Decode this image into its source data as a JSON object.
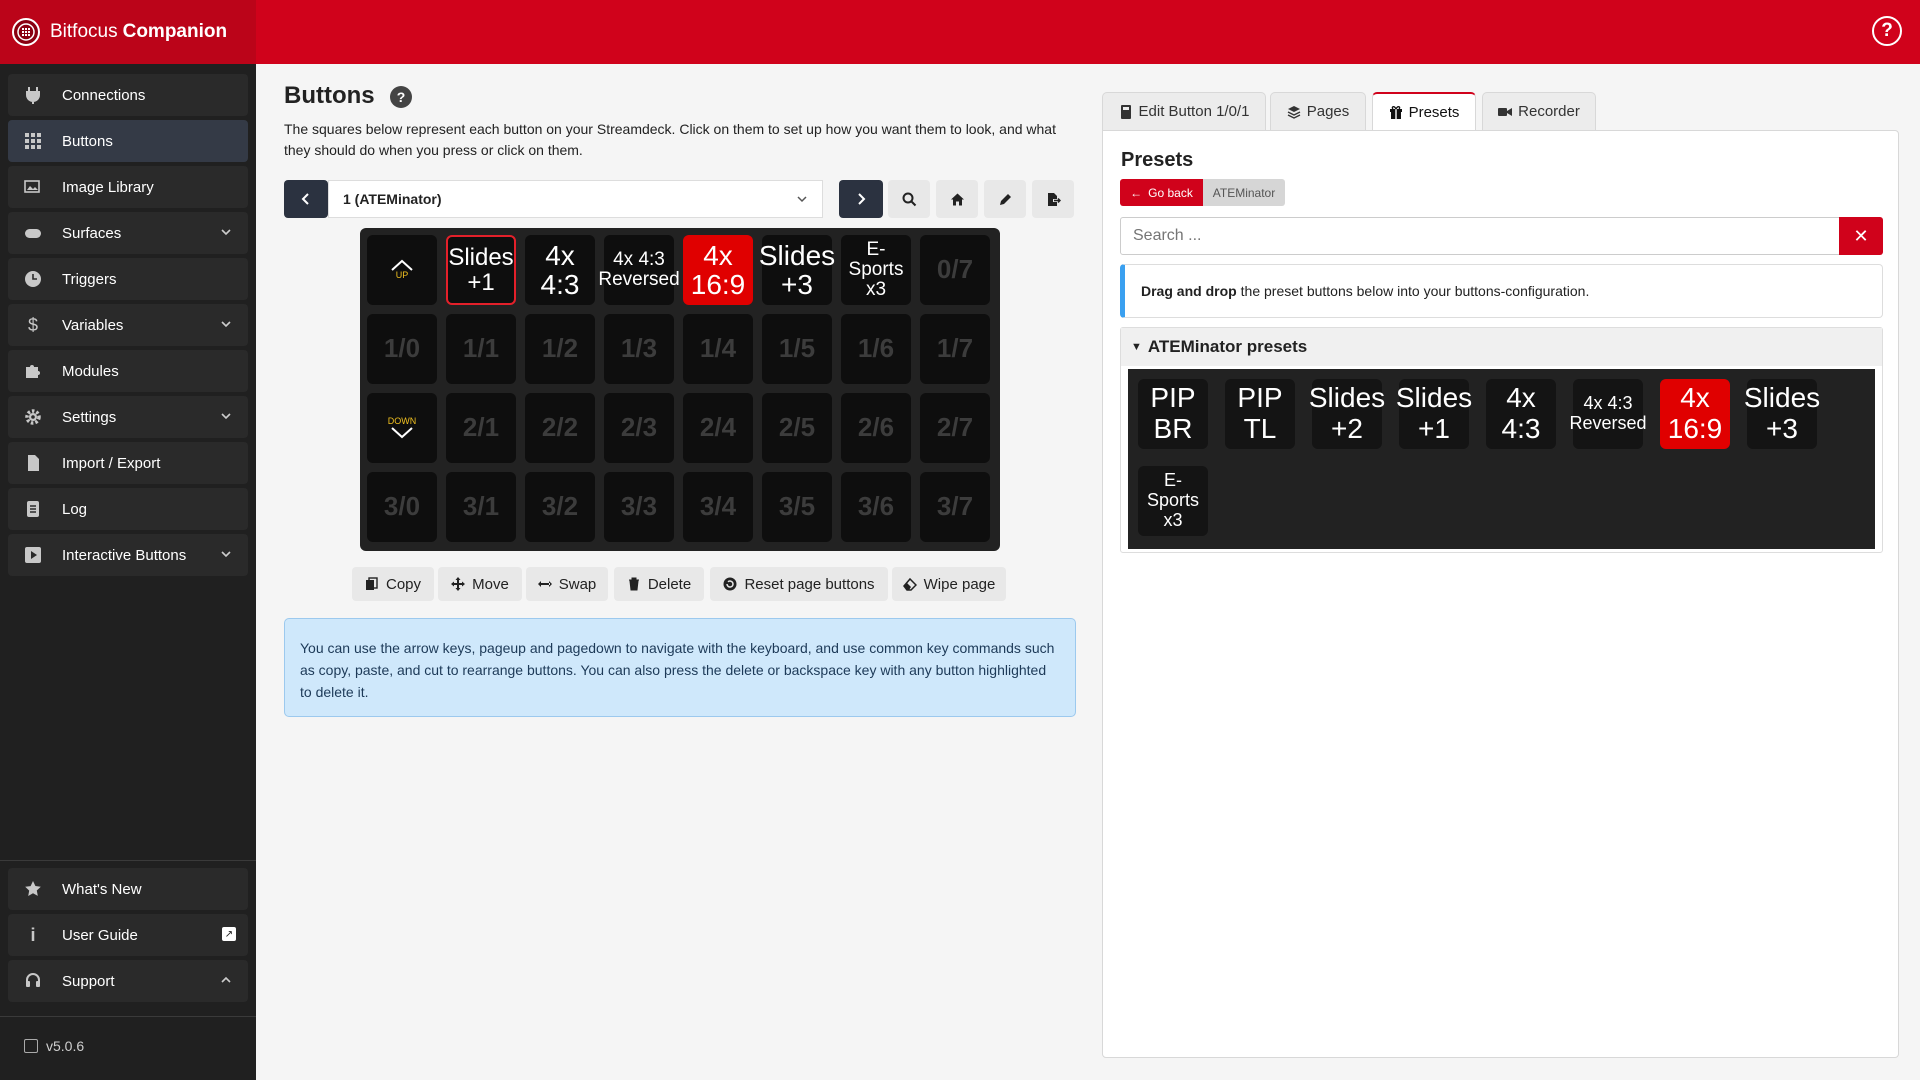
{
  "app": {
    "name_light": "Bitfocus",
    "name_bold": "Companion",
    "help_label": "?"
  },
  "sidebar": {
    "items": [
      {
        "label": "Connections",
        "icon": "plug-icon"
      },
      {
        "label": "Buttons",
        "icon": "grid-icon",
        "active": true
      },
      {
        "label": "Image Library",
        "icon": "image-icon"
      },
      {
        "label": "Surfaces",
        "icon": "gamepad-icon",
        "expandable": true
      },
      {
        "label": "Triggers",
        "icon": "clock-icon"
      },
      {
        "label": "Variables",
        "icon": "dollar-icon",
        "expandable": true
      },
      {
        "label": "Modules",
        "icon": "puzzle-icon"
      },
      {
        "label": "Settings",
        "icon": "gear-icon",
        "expandable": true
      },
      {
        "label": "Import / Export",
        "icon": "file-import-icon"
      },
      {
        "label": "Log",
        "icon": "log-icon"
      },
      {
        "label": "Interactive Buttons",
        "icon": "play-icon",
        "expandable": true
      }
    ],
    "bottom": [
      {
        "label": "What's New",
        "icon": "star-icon"
      },
      {
        "label": "User Guide",
        "icon": "info-icon"
      },
      {
        "label": "Support",
        "icon": "headset-icon"
      }
    ],
    "version": "v5.0.6"
  },
  "buttons_page": {
    "title": "Buttons",
    "description": "The squares below represent each button on your Streamdeck. Click on them to set up how you want them to look, and what they should do when you press or click on them.",
    "page_select": "1 (ATEMinator)",
    "grid": [
      [
        "UP",
        "Slides +1",
        "4x 4:3",
        "4x 4:3 Reversed",
        "4x 16:9",
        "Slides +3",
        "E-Sports x3",
        "0/7"
      ],
      [
        "1/0",
        "1/1",
        "1/2",
        "1/3",
        "1/4",
        "1/5",
        "1/6",
        "1/7"
      ],
      [
        "DOWN",
        "2/1",
        "2/2",
        "2/3",
        "2/4",
        "2/5",
        "2/6",
        "2/7"
      ],
      [
        "3/0",
        "3/1",
        "3/2",
        "3/3",
        "3/4",
        "3/5",
        "3/6",
        "3/7"
      ]
    ],
    "actions": {
      "copy": "Copy",
      "move": "Move",
      "swap": "Swap",
      "delete": "Delete",
      "reset": "Reset page buttons",
      "wipe": "Wipe page"
    },
    "info": "You can use the arrow keys, pageup and pagedown to navigate with the keyboard, and use common key commands such as copy, paste, and cut to rearrange buttons. You can also press the delete or backspace key with any button highlighted to delete it."
  },
  "right_panel": {
    "tabs": [
      "Edit Button 1/0/1",
      "Pages",
      "Presets",
      "Recorder"
    ],
    "active_tab": "Presets",
    "title": "Presets",
    "go_back": "Go back",
    "breadcrumb": "ATEMinator",
    "search_placeholder": "Search ...",
    "dnd_bold": "Drag and drop",
    "dnd_text": "the preset buttons below into your buttons-configuration.",
    "group_title": "ATEMinator presets",
    "presets": [
      "PIP BR",
      "PIP TL",
      "Slides +2",
      "Slides +1",
      "4x 4:3",
      "4x 4:3 Reversed",
      "4x 16:9",
      "Slides +3",
      "E-Sports x3"
    ]
  },
  "colors": {
    "brand_red": "#d0021b",
    "highlight_red": "#e00000",
    "sidebar_bg": "#202020"
  }
}
